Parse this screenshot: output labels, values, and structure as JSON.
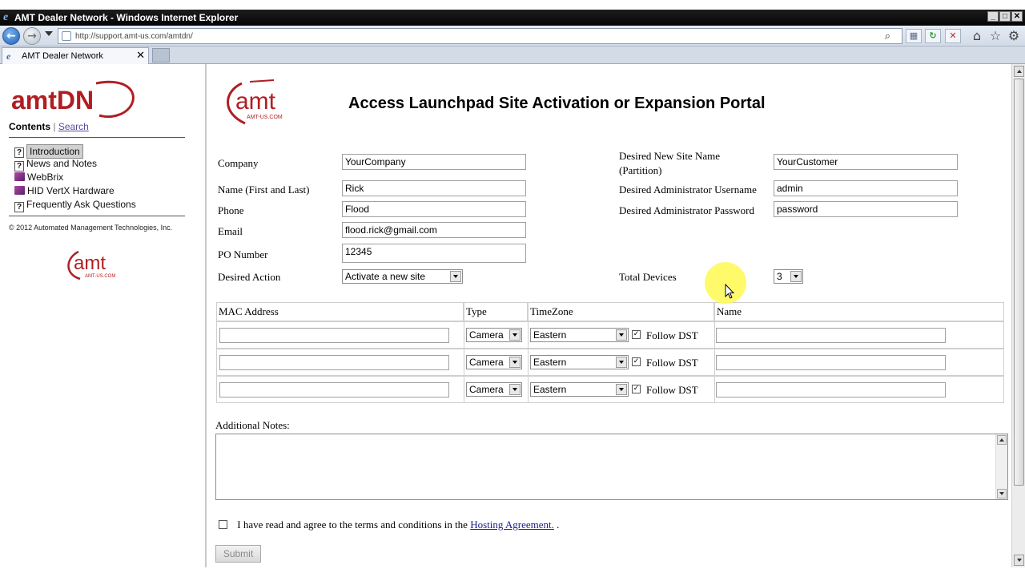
{
  "window": {
    "title": "AMT Dealer Network - Windows Internet Explorer",
    "url": "http://support.amt-us.com/amtdn/",
    "tab_label": "AMT Dealer Network"
  },
  "sidebar": {
    "logo_text": "amtDN",
    "contents_label": "Contents",
    "separator": "|",
    "search_label": "Search",
    "items": [
      {
        "label": "Introduction",
        "icon": "help-page-icon"
      },
      {
        "label": "News and Notes",
        "icon": "help-page-icon"
      },
      {
        "label": "WebBrix",
        "icon": "book-icon"
      },
      {
        "label": "HID VertX Hardware",
        "icon": "book-icon"
      },
      {
        "label": "Frequently Ask Questions",
        "icon": "help-page-icon"
      }
    ],
    "copyright": "© 2012 Automated Management Technologies, Inc.",
    "small_logo_text": "amt",
    "small_logo_sub": "AMT-US.COM"
  },
  "main": {
    "logo_text": "amt",
    "logo_sub": "AMT-US.COM",
    "title": "Access Launchpad Site Activation or Expansion Portal",
    "form": {
      "company_label": "Company",
      "company_value": "YourCompany",
      "name_label": "Name (First and Last)",
      "name_value": "Rick",
      "phone_label": "Phone",
      "phone_value": "Flood",
      "email_label": "Email",
      "email_value": "flood.rick@gmail.com",
      "po_label": "PO Number",
      "po_value": "12345",
      "action_label": "Desired Action",
      "action_value": "Activate a new site",
      "site_label_1": "Desired New Site Name",
      "site_label_2": "(Partition)",
      "site_value": "YourCustomer",
      "admin_user_label": "Desired Administrator Username",
      "admin_user_value": "admin",
      "admin_pass_label": "Desired Administrator Password",
      "admin_pass_value": "password",
      "devices_label": "Total Devices",
      "devices_value": "3"
    },
    "device_table": {
      "headers": [
        "MAC Address",
        "Type",
        "TimeZone",
        "Name"
      ],
      "rows": [
        {
          "mac": "",
          "type": "Camera",
          "timezone": "Eastern",
          "follow_dst": "Follow DST",
          "dst_checked": true,
          "name": ""
        },
        {
          "mac": "",
          "type": "Camera",
          "timezone": "Eastern",
          "follow_dst": "Follow DST",
          "dst_checked": true,
          "name": ""
        },
        {
          "mac": "",
          "type": "Camera",
          "timezone": "Eastern",
          "follow_dst": "Follow DST",
          "dst_checked": true,
          "name": ""
        }
      ]
    },
    "notes_label": "Additional Notes:",
    "agree_text": "I have read and agree to the terms and conditions in the",
    "agree_link": "Hosting Agreement.",
    "agree_tail": ".",
    "submit_label": "Submit"
  },
  "colors": {
    "brand_red": "#b01e24",
    "link": "#1a1a8c",
    "cursor_highlight": "#fff95a"
  }
}
